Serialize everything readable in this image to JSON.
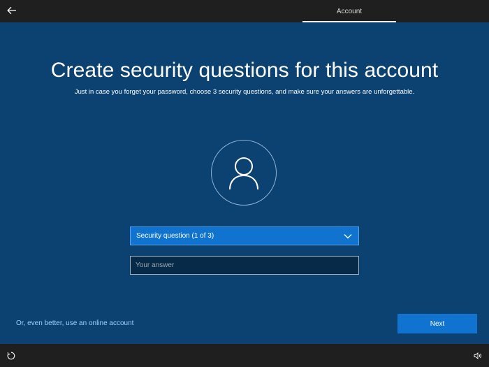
{
  "topbar": {
    "back_icon": "back-arrow-icon",
    "tab_label": "Account"
  },
  "main": {
    "title": "Create security questions for this account",
    "subtitle": "Just in case you forget your password, choose 3 security questions, and make sure your answers are unforgettable.",
    "avatar_icon": "user-icon",
    "security_question": {
      "selected": "Security question (1 of 3)",
      "icon": "chevron-down-icon"
    },
    "answer": {
      "value": "",
      "placeholder": "Your answer"
    },
    "online_account_link": "Or, even better, use an online account",
    "next_label": "Next"
  },
  "bottombar": {
    "ease_of_access_icon": "ease-of-access-icon",
    "volume_icon": "volume-icon"
  },
  "colors": {
    "background": "#0b4272",
    "bar": "#1f1f1f",
    "accent": "#0f73cf",
    "input_bg": "#062a48",
    "link": "#9fd0ff"
  }
}
